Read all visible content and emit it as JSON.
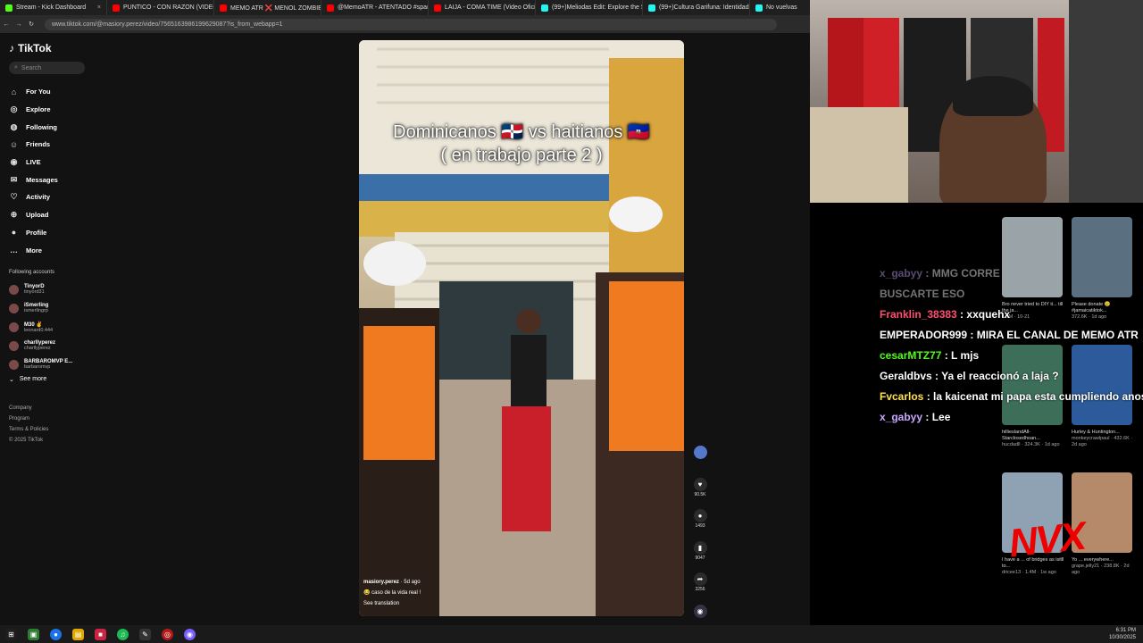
{
  "browser": {
    "tabs": [
      {
        "title": "Stream - Kick Dashboard",
        "color": "#53fc18"
      },
      {
        "title": "PUNTICO - CON RAZON (VIDEO",
        "color": "#ff0000"
      },
      {
        "title": "MEMO ATR ❌ MENOL ZOMBIE",
        "color": "#ff0000"
      },
      {
        "title": "@MemoATR - ATENTADO #span",
        "color": "#ff0000"
      },
      {
        "title": "LAIJA - COMA TIME (Video Oficial",
        "color": "#ff0000"
      },
      {
        "title": "(99+)Meliodas Edit: Explore the S",
        "color": "#25f4ee"
      },
      {
        "title": "(99+)Cultura Garifuna: Identidad",
        "color": "#25f4ee"
      },
      {
        "title": "No vuelvas",
        "color": "#25f4ee"
      }
    ],
    "url": "www.tiktok.com/@masiory.perez/video/7565163986199629087?is_from_webapp=1"
  },
  "sidebar": {
    "logo": "TikTok",
    "search_placeholder": "Search",
    "nav": [
      {
        "label": "For You",
        "icon": "home-icon"
      },
      {
        "label": "Explore",
        "icon": "compass-icon"
      },
      {
        "label": "Following",
        "icon": "following-icon"
      },
      {
        "label": "Friends",
        "icon": "friends-icon"
      },
      {
        "label": "LIVE",
        "icon": "live-icon"
      },
      {
        "label": "Messages",
        "icon": "messages-icon"
      },
      {
        "label": "Activity",
        "icon": "activity-icon"
      },
      {
        "label": "Upload",
        "icon": "upload-icon"
      },
      {
        "label": "Profile",
        "icon": "profile-icon"
      },
      {
        "label": "More",
        "icon": "more-icon"
      }
    ],
    "following_title": "Following accounts",
    "accounts": [
      {
        "name": "TinyorD",
        "handle": "tinyord31"
      },
      {
        "name": "iSmerling",
        "handle": "ismerlingrp"
      },
      {
        "name": "M30 ✌",
        "handle": "leonard0.444"
      },
      {
        "name": "charllyperez",
        "handle": "charllyperez"
      },
      {
        "name": "BARBAROMVP E...",
        "handle": "barbaromvp"
      }
    ],
    "see_more": "See more",
    "footer": [
      "Company",
      "Program",
      "Terms & Policies",
      "© 2025 TikTok"
    ]
  },
  "video": {
    "title_line1": "Dominicanos 🇩🇴 vs haitianos 🇭🇹",
    "title_line2": "( en trabajo parte 2 )",
    "author": "masiory.perez",
    "age": "· 5d ago",
    "caption": "😂 caso de la vida real !",
    "see_translation": "See translation",
    "likes": "90.5K",
    "comments": "1493",
    "saves": "9047",
    "shares": "3256"
  },
  "chat": [
    {
      "user": "x_gabyy",
      "msg": "MMG CORRE",
      "color": "#c9a6ff"
    },
    {
      "user": "",
      "msg": "BUSCARTE ESO",
      "color": "#ffffff"
    },
    {
      "user": "Franklin_38383",
      "msg": "xxquehx",
      "color": "#ff4d6d"
    },
    {
      "user": "EMPERADOR999",
      "msg": "MIRA EL CANAL DE MEMO ATR",
      "color": "#ffffff"
    },
    {
      "user": "cesarMTZ77",
      "msg": "L mjs",
      "color": "#53fc18"
    },
    {
      "user": "Geraldbvs",
      "msg": "Ya el reaccionó a laja ?",
      "color": "#ffffff"
    },
    {
      "user": "Fvcarlos",
      "msg": "la kaicenat mi papa esta cumpliendo anos",
      "color": "#ffe14d"
    },
    {
      "user": "x_gabyy",
      "msg": "Lee",
      "color": "#c9a6ff"
    }
  ],
  "thumbs": [
    {
      "title": "Bro never tried to DIY it... till the ja...",
      "meta": "1.1M · 10-21"
    },
    {
      "title": "Please donate 😢 #jamaicatiktok...",
      "meta": "372.6K · 1d ago"
    },
    {
      "title": "hillieslandAll-Starclosedhoan...",
      "meta": "hucdadll · 324.3K · 1d ago"
    },
    {
      "title": "Hurley & Huntington...",
      "meta": "monkeycrawlpaul · 432.6K · 2d ago"
    },
    {
      "title": "I have a ... of bridges as isitll to...",
      "meta": "dricee13 · 1.4M · 1w ago"
    },
    {
      "title": "Yo ... everywhere...",
      "meta": "grape.jelly21 · 238.8K · 2d ago"
    }
  ],
  "overlay_logo": "NVX",
  "clock": {
    "time": "6:31 PM",
    "date": "10/30/2025"
  }
}
